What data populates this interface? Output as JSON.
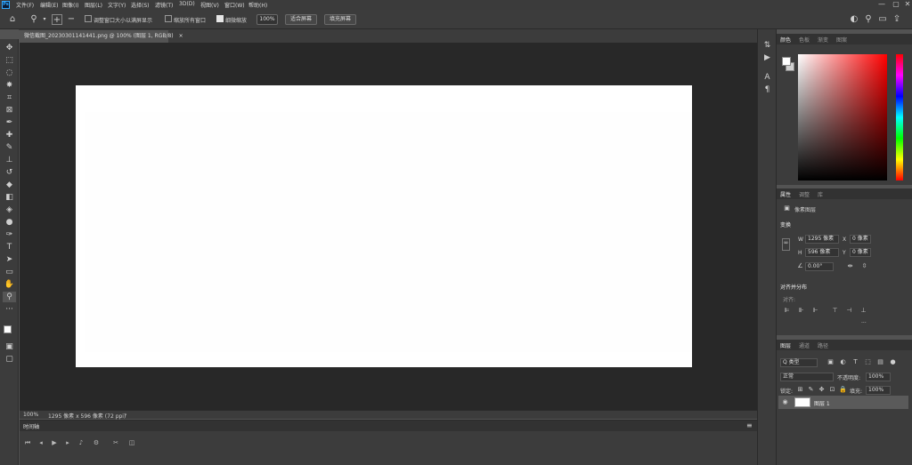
{
  "app": {
    "logo": "Ps"
  },
  "menu": [
    "文件(F)",
    "编辑(E)",
    "图像(I)",
    "图层(L)",
    "文字(Y)",
    "选择(S)",
    "滤镜(T)",
    "3D(D)",
    "视图(V)",
    "窗口(W)",
    "帮助(H)"
  ],
  "window": {
    "min": "—",
    "max": "▢",
    "close": "✕"
  },
  "options": {
    "resize_label": "调整窗口大小以满屏显示",
    "zoom_all_label": "缩放所有窗口",
    "scrubby_label": "细微缩放",
    "zoom_value": "100%",
    "fit_btn": "适合屏幕",
    "fill_btn": "填充屏幕"
  },
  "doc_tab": {
    "title": "微信截图_20230301141441.png @ 100% (图层 1, RGB/8)",
    "close": "×"
  },
  "status": {
    "zoom": "100%",
    "info": "1295 像素 x 596 像素 (72 ppi)",
    "arrow": "›"
  },
  "timeline": {
    "title": "时间轴",
    "menu": "≡"
  },
  "color_panel": {
    "tabs": [
      "颜色",
      "色板",
      "渐变",
      "图案"
    ]
  },
  "properties_panel": {
    "tabs": [
      "属性",
      "调整",
      "库"
    ],
    "doc_type": "像素图层",
    "transform_title": "变换",
    "w_label": "W",
    "w_value": "1295 像素",
    "x_label": "X",
    "x_value": "0 像素",
    "h_label": "H",
    "h_value": "596 像素",
    "y_label": "Y",
    "y_value": "0 像素",
    "angle_value": "0.00°",
    "align_title": "对齐并分布",
    "align_sub": "对齐:",
    "more": "..."
  },
  "layers_panel": {
    "tabs": [
      "图层",
      "通道",
      "路径"
    ],
    "filter_label": "Q 类型",
    "blend_mode": "正常",
    "opacity_label": "不透明度:",
    "opacity_value": "100%",
    "lock_label": "锁定:",
    "fill_label": "填充:",
    "fill_value": "100%",
    "layer_name": "图层 1"
  },
  "colors": {
    "fg": "#ffffff",
    "bg": "#cfcfcf",
    "accent": "#31a8ff"
  }
}
